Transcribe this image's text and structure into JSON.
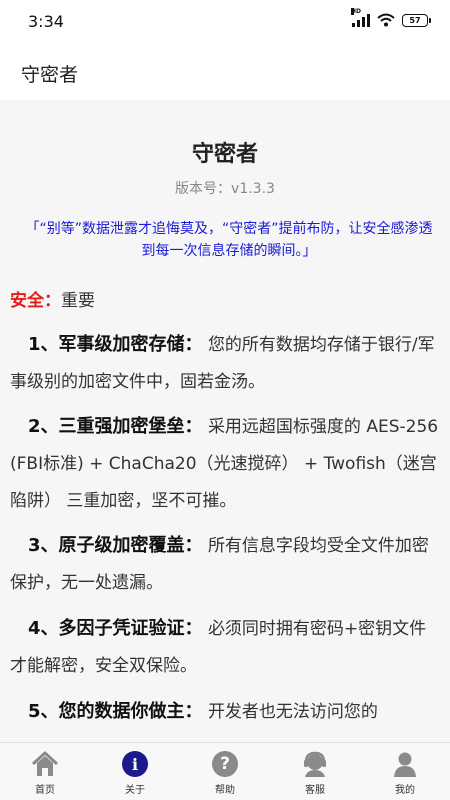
{
  "status_bar": {
    "time": "3:34",
    "network": "HD",
    "battery": "57"
  },
  "header": {
    "title": "守密者"
  },
  "main": {
    "title": "守密者",
    "version": "版本号：v1.3.3",
    "slogan": "「“别等”数据泄露才追悔莫及，“守密者”提前布防，让安全感渗透到每一次信息存储的瞬间。」",
    "security_label": "安全：",
    "security_value": "重要",
    "features": [
      {
        "title": "1、军事级加密存储：",
        "text": "您的所有数据均存储于银行/军事级别的加密文件中，固若金汤。"
      },
      {
        "title": "2、三重强加密堡垒：",
        "text": "采用远超国标强度的 AES-256 (FBI标准) + ChaCha20（光速搅碎） + Twofish（迷宫陷阱） 三重加密，坚不可摧。"
      },
      {
        "title": "3、原子级加密覆盖：",
        "text": "所有信息字段均受全文件加密保护，无一处遗漏。"
      },
      {
        "title": "4、多因子凭证验证：",
        "text": "必须同时拥有密码+密钥文件才能解密，安全双保险。"
      },
      {
        "title": "5、您的数据你做主：",
        "text": "开发者也无法访问您的"
      }
    ]
  },
  "bottom_nav": {
    "items": [
      {
        "label": "首页",
        "icon": "home-icon",
        "active": false
      },
      {
        "label": "关于",
        "icon": "info-icon",
        "active": true
      },
      {
        "label": "帮助",
        "icon": "help-icon",
        "active": false
      },
      {
        "label": "客服",
        "icon": "customer-service-icon",
        "active": false
      },
      {
        "label": "我的",
        "icon": "profile-icon",
        "active": false
      }
    ]
  },
  "colors": {
    "accent": "#1a1a8c",
    "slogan": "#1a1ad8",
    "security_label": "#e81b1b",
    "icon_gray": "#8a8a8a"
  }
}
